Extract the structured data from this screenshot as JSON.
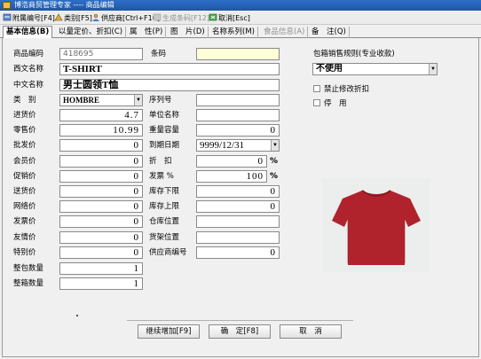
{
  "window": {
    "title": "博浩商贸管理专家 ---- 商品编辑"
  },
  "toolbar": {
    "attach_code": "附属编号[F4]",
    "category": "类别[F5]",
    "supplier": "供应商[Ctrl+F10]",
    "generate_barcode": "生成条码[F12]",
    "cancel": "取消[Esc]"
  },
  "tabs": [
    {
      "label": "基本信息(B)"
    },
    {
      "label": "以量定价、折扣(C)"
    },
    {
      "label": "属　性(P)"
    },
    {
      "label": "图　片(D)"
    },
    {
      "label": "名称系列(M)"
    },
    {
      "label": "食品信息(A)"
    },
    {
      "label": "备　注(Q)"
    }
  ],
  "form": {
    "product_code": {
      "label": "商品编码",
      "value": "418695"
    },
    "barcode": {
      "label": "条码",
      "value": ""
    },
    "western_name": {
      "label": "西文名称",
      "value": "T-SHIRT"
    },
    "chinese_name": {
      "label": "中文名称",
      "value": "男士圆领T恤"
    },
    "category": {
      "label": "类　别",
      "value": "HOMBRE"
    },
    "serial_no": {
      "label": "序列号",
      "value": ""
    },
    "purchase_price": {
      "label": "进货价",
      "value": "4.7"
    },
    "unit_name": {
      "label": "单位名称",
      "value": ""
    },
    "retail_price": {
      "label": "零售价",
      "value": "10.99"
    },
    "weight_capacity": {
      "label": "重量容量",
      "value": "0"
    },
    "wholesale_price": {
      "label": "批发价",
      "value": "0"
    },
    "expiry_date": {
      "label": "到期日期",
      "value": "9999/12/31"
    },
    "member_price": {
      "label": "会员价",
      "value": "0"
    },
    "discount": {
      "label": "折　扣",
      "value": "0",
      "unit": "%"
    },
    "promo_price": {
      "label": "促销价",
      "value": "0"
    },
    "invoice_pct": {
      "label": "发票 %",
      "value": "100",
      "unit": "%"
    },
    "delivery_price": {
      "label": "送货价",
      "value": "0"
    },
    "stock_min": {
      "label": "库存下限",
      "value": "0"
    },
    "online_price": {
      "label": "网络价",
      "value": "0"
    },
    "stock_max": {
      "label": "库存上限",
      "value": "0"
    },
    "invoice_price": {
      "label": "发票价",
      "value": "0"
    },
    "warehouse_location": {
      "label": "仓库位置",
      "value": ""
    },
    "friend_price": {
      "label": "友情价",
      "value": "0"
    },
    "shelf_location": {
      "label": "货架位置",
      "value": ""
    },
    "special_price": {
      "label": "特别价",
      "value": "0"
    },
    "supplier_code": {
      "label": "供应商编号",
      "value": "0"
    },
    "pack_qty": {
      "label": "整包数量",
      "value": "1"
    },
    "box_qty": {
      "label": "整箱数量",
      "value": "1"
    }
  },
  "right_panel": {
    "pack_rule_label": "包箱销售规则(专业收款)",
    "pack_rule_value": "不使用",
    "forbid_discount": "禁止修改折扣",
    "disabled": "停　用"
  },
  "product_image": {
    "color": "#b0232c",
    "background": "#eceeee"
  },
  "buttons": {
    "continue_add": "继续增加[F9]",
    "confirm": "确　定[F8]",
    "cancel": "取　消"
  }
}
